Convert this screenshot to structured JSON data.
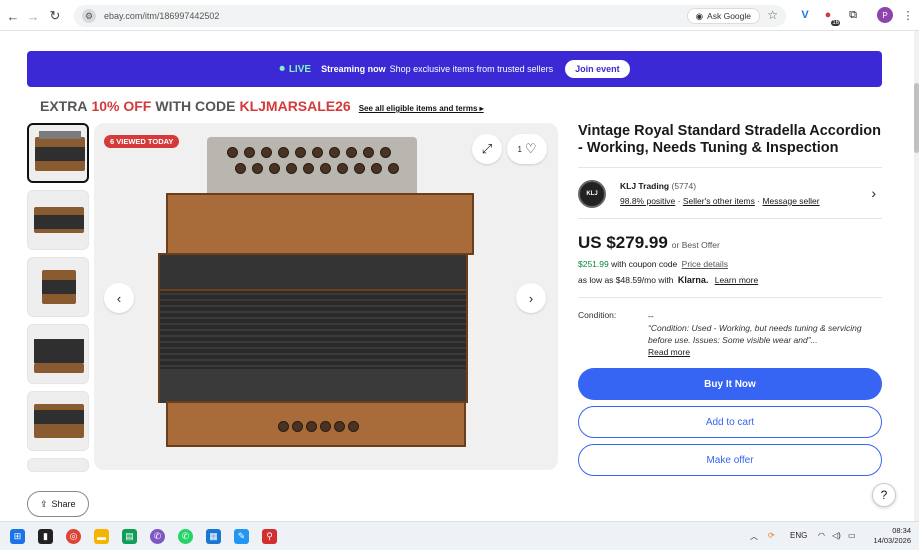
{
  "browser": {
    "url": "ebay.com/itm/186997442502",
    "ask_google": "Ask Google",
    "profile_initial": "P",
    "ext_badge": "16"
  },
  "banner": {
    "live": "LIVE",
    "streaming": "Streaming now",
    "text": "Shop exclusive items from trusted sellers",
    "join": "Join event"
  },
  "promo": {
    "prefix": "EXTRA",
    "percent": "10% OFF",
    "mid": "WITH CODE",
    "code": "KLJMARSALE26",
    "link": "See all eligible items and terms ▸"
  },
  "gallery": {
    "viewed": "6 VIEWED TODAY",
    "watch_count": "1"
  },
  "listing": {
    "title": "Vintage Royal Standard Stradella Accordion - Working, Needs Tuning & Inspection",
    "seller_logo": "KLJ",
    "seller_name": "KLJ Trading",
    "seller_count": "(5774)",
    "positive": "98.8% positive",
    "other_items": "Seller's other items",
    "message": "Message seller",
    "price": "US $279.99",
    "best_offer": "or Best Offer",
    "coupon_price": "$251.99",
    "coupon_text": "with coupon code",
    "price_details": "Price details",
    "klarna_prefix": "as low as $48.59/mo with",
    "klarna": "Klarna.",
    "learn_more": "Learn more",
    "condition_label": "Condition:",
    "condition_value": "--",
    "condition_quote": "“Condition: Used - Working, but needs tuning & servicing before use. Issues: Some visible wear and”...",
    "read_more": "Read more",
    "buy_now": "Buy It Now",
    "add_cart": "Add to cart",
    "make_offer": "Make offer"
  },
  "share": "Share",
  "help": "?",
  "taskbar": {
    "lang": "ENG",
    "time": "08:34",
    "date": "14/03/2026"
  },
  "colors": {
    "banner": "#3b29d6",
    "ebay_blue": "#3665f3",
    "promo_red": "#d53a3a",
    "coupon_green": "#098a3d"
  }
}
